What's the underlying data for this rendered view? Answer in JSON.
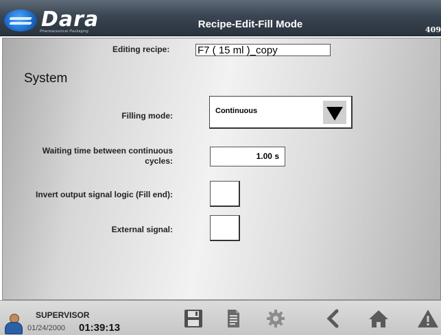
{
  "header": {
    "logo_text": "Dara",
    "logo_subtitle": "Pharmaceutical Packaging",
    "title": "Recipe-Edit-Fill Mode",
    "screen_number": "409"
  },
  "editing": {
    "label": "Editing recipe:",
    "value": "F7 ( 15 ml )_copy"
  },
  "section": {
    "title": "System"
  },
  "fields": {
    "filling_mode": {
      "label": "Filling mode:",
      "value": "Continuous"
    },
    "waiting_time": {
      "label_line1": "Waiting time between continuous",
      "label_line2": "cycles:",
      "value": "1.00 s"
    },
    "invert_output": {
      "label": "Invert output signal logic (Fill end):",
      "checked": false
    },
    "external_signal": {
      "label": "External signal:",
      "checked": false
    }
  },
  "footer": {
    "user": "SUPERVISOR",
    "date": "01/24/2000",
    "time": "01:39:13",
    "icons": [
      "save-icon",
      "document-icon",
      "gear-icon",
      "back-icon",
      "home-icon",
      "warning-icon"
    ]
  },
  "colors": {
    "header_bg": "#3a4552",
    "panel_bg": "#e6e6e6",
    "logo_blue": "#1f6fd0",
    "footer_icon": "#5a5a5a"
  }
}
